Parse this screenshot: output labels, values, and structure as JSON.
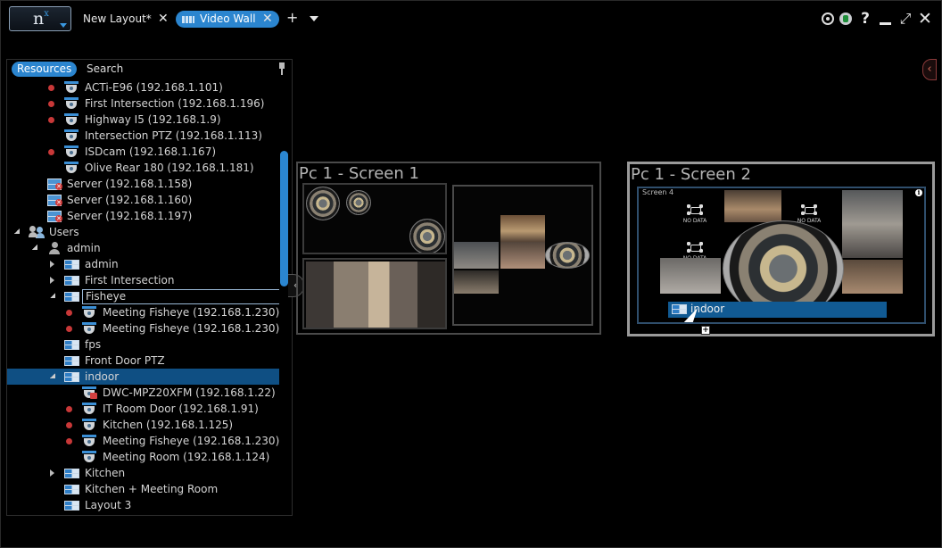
{
  "titlebar": {
    "logo_text": "n",
    "logo_sup": "x",
    "tabs": [
      {
        "label": "New Layout*"
      },
      {
        "label": "Video Wall"
      }
    ],
    "add_tab": "+",
    "help": "?"
  },
  "panel": {
    "tabs": {
      "resources": "Resources",
      "search": "Search"
    },
    "tree": [
      {
        "label": "ACTi-E96 (192.168.1.101)"
      },
      {
        "label": "First Intersection (192.168.1.196)"
      },
      {
        "label": "Highway I5 (192.168.1.9)"
      },
      {
        "label": "Intersection PTZ (192.168.1.113)"
      },
      {
        "label": "ISDcam (192.168.1.167)"
      },
      {
        "label": "Olive Rear 180 (192.168.1.181)"
      },
      {
        "label": "Server (192.168.1.158)"
      },
      {
        "label": "Server (192.168.1.160)"
      },
      {
        "label": "Server (192.168.1.197)"
      },
      {
        "label": "Users"
      },
      {
        "label": "admin"
      },
      {
        "label": "admin"
      },
      {
        "label": "First Intersection"
      },
      {
        "label": "Fisheye"
      },
      {
        "label": "Meeting Fisheye (192.168.1.230)"
      },
      {
        "label": "Meeting Fisheye (192.168.1.230)"
      },
      {
        "label": "fps"
      },
      {
        "label": "Front Door PTZ"
      },
      {
        "label": "indoor"
      },
      {
        "label": "DWC-MPZ20XFM (192.168.1.22)"
      },
      {
        "label": "IT Room Door (192.168.1.91)"
      },
      {
        "label": "Kitchen (192.168.1.125)"
      },
      {
        "label": "Meeting Fisheye (192.168.1.230)"
      },
      {
        "label": "Meeting Room (192.168.1.124)"
      },
      {
        "label": "Kitchen"
      },
      {
        "label": "Kitchen + Meeting Room"
      },
      {
        "label": "Layout 3"
      }
    ]
  },
  "wall": {
    "screen1_title": "Pc 1 - Screen 1",
    "screen2_title": "Pc 1 - Screen 2",
    "screen4_label": "Screen 4",
    "info": "i",
    "nodata_text": "NO DATA",
    "drop_label": "indoor",
    "plus": "+"
  },
  "colors": {
    "accent": "#2b85cf",
    "selected": "#0f4f83",
    "recording": "#c83838"
  }
}
